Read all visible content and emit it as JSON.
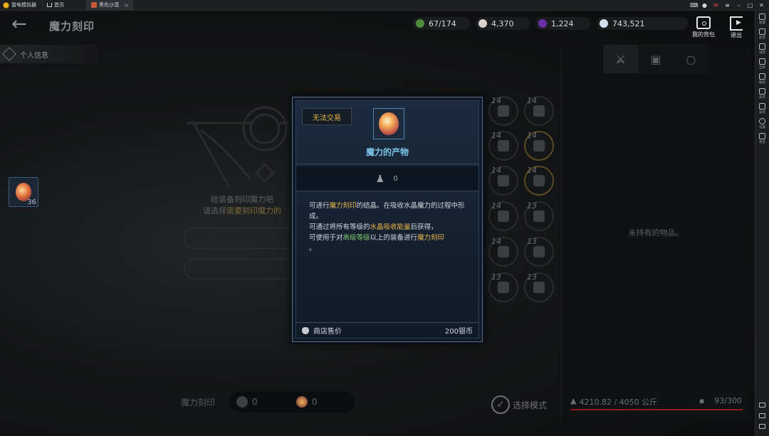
{
  "emulator": {
    "app_name": "雷电模拟器",
    "tabs": [
      {
        "label": "首页"
      },
      {
        "label": "黑色沙漠"
      }
    ]
  },
  "sidebar": {
    "items": [
      {
        "label": "按键"
      },
      {
        "label": "加音"
      },
      {
        "label": "减音"
      },
      {
        "label": "全屏"
      },
      {
        "label": "截屏"
      },
      {
        "label": "多开"
      },
      {
        "label": "安装"
      },
      {
        "label": "设置"
      },
      {
        "label": "更多"
      }
    ]
  },
  "header": {
    "title": "魔力刻印",
    "resources": [
      {
        "value": "67/174",
        "color": "#4e8d3a"
      },
      {
        "value": "4,370",
        "color": "#d9d2cc"
      },
      {
        "value": "1,224",
        "color": "#6b2fa8"
      },
      {
        "value": "743,521",
        "color": "#cfe0ef"
      }
    ],
    "bag_label": "我的背包",
    "exit_label": "退出"
  },
  "left": {
    "personal_tab": "个人信息",
    "item_count": "36",
    "hint_line1": "给装备刻印魔力吧",
    "hint_line2_pre": "请选择",
    "hint_line2_hl": "需要刻印魔力的",
    "hint_line2_post": ""
  },
  "grid": {
    "levels": [
      "14",
      "14",
      "14",
      "14",
      "14",
      "14",
      "14",
      "13",
      "14",
      "13",
      "13",
      "13"
    ]
  },
  "bottom": {
    "label": "魔力刻印",
    "value1": "0",
    "value2": "0",
    "select_mode": "选择模式"
  },
  "inventory": {
    "empty_text": "未持有的物品。",
    "weight": "4210.82 / 4050 公斤",
    "slots": "93/300"
  },
  "tooltip": {
    "trade_badge": "无法交易",
    "item_name": "魔力的产物",
    "weight_value": "0",
    "desc": {
      "p1_a": "可进行",
      "p1_b": "魔力刻印",
      "p1_c": "的结晶。在吸收水晶魔力的过程中形成。",
      "p2_a": "可通过将所有等级的",
      "p2_b": "水晶吸收能量",
      "p2_c": "后获得，",
      "p3_a": "可使用于对",
      "p3_b": "高级等级",
      "p3_c": "以上的装备进行",
      "p3_d": "魔力刻印",
      "p3_e": "。"
    },
    "price_label": "商店售价",
    "price_value": "200银币"
  }
}
